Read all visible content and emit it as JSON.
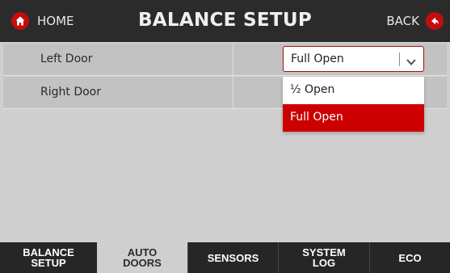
{
  "header": {
    "home_label": "HOME",
    "title": "BALANCE SETUP",
    "back_label": "BACK"
  },
  "settings": [
    {
      "label": "Left Door",
      "value": "Full Open"
    },
    {
      "label": "Right Door"
    }
  ],
  "dropdown": {
    "options": [
      "½ Open",
      "Full Open"
    ],
    "selected": "Full Open"
  },
  "tabs": [
    {
      "label": "BALANCE SETUP",
      "active": false
    },
    {
      "label": "AUTO DOORS",
      "active": true
    },
    {
      "label": "SENSORS",
      "active": false
    },
    {
      "label": "SYSTEM LOG",
      "active": false
    },
    {
      "label": "ECO",
      "active": false
    }
  ],
  "colors": {
    "accent": "#cc0000",
    "header_bg": "#2b2b2b",
    "content_bg": "#cfcfcf",
    "row_bg": "#c2c2c2"
  },
  "icons": {
    "home": "home-icon",
    "back": "back-arrow-icon",
    "dropdown": "chevron-down-icon"
  }
}
